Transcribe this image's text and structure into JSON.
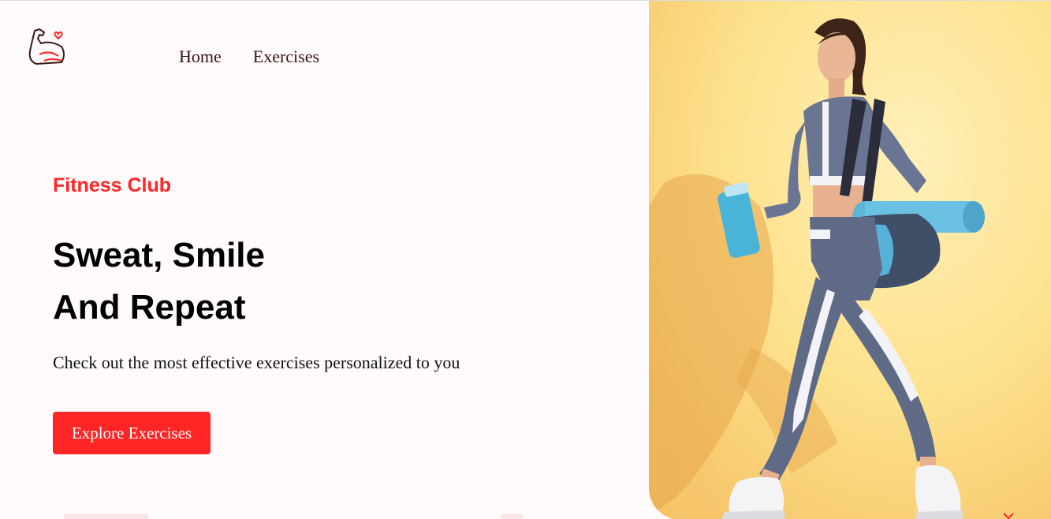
{
  "nav": {
    "home_label": "Home",
    "exercises_label": "Exercises"
  },
  "hero": {
    "eyebrow": "Fitness Club",
    "headline_line1": "Sweat, Smile",
    "headline_line2": "And Repeat",
    "subtext": "Check out the most effective exercises personalized to you",
    "cta_label": "Explore Exercises"
  },
  "icons": {
    "logo": "flexed-bicep-heart-icon"
  },
  "colors": {
    "accent": "#ff2625",
    "background": "#fffafb",
    "nav_text": "#3a1212",
    "hero_bg": "#fde08a"
  }
}
